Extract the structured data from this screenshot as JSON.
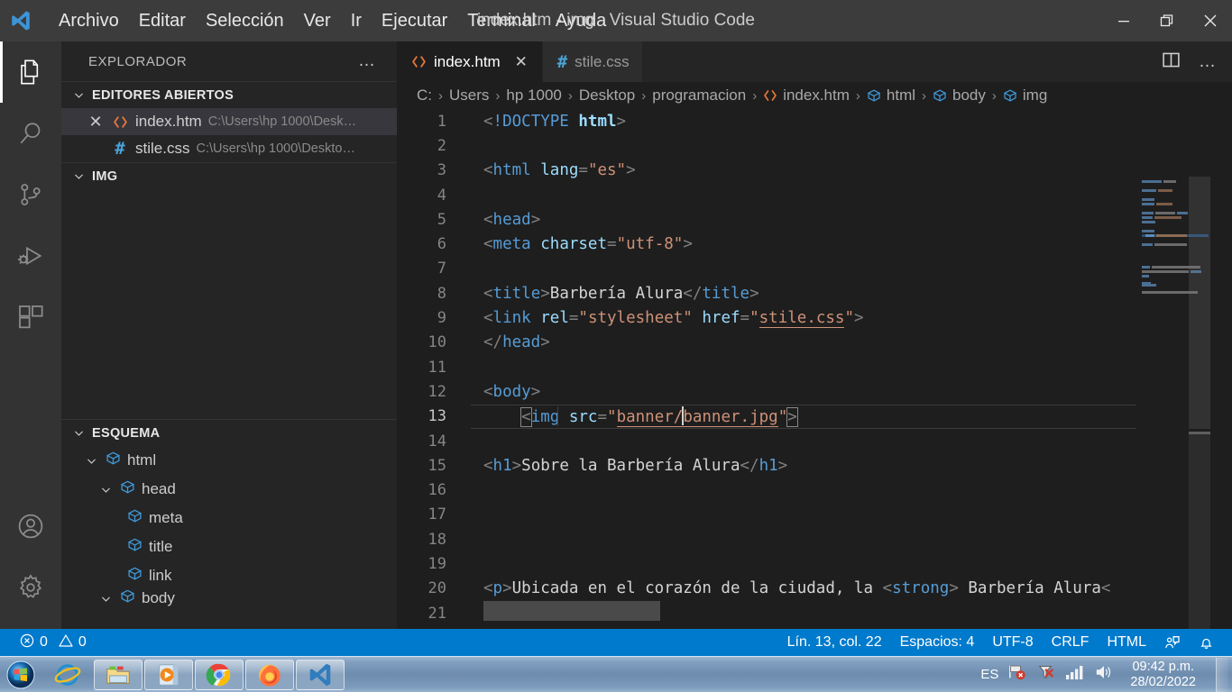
{
  "window": {
    "title": "index.htm - img - Visual Studio Code",
    "minimize": "minimize-icon",
    "restore": "restore-icon",
    "close": "close-icon"
  },
  "menubar": {
    "items": [
      {
        "label": "Archivo"
      },
      {
        "label": "Editar"
      },
      {
        "label": "Selección"
      },
      {
        "label": "Ver"
      },
      {
        "label": "Ir"
      },
      {
        "label": "Ejecutar"
      },
      {
        "label": "Terminal"
      },
      {
        "label": "Ayuda"
      }
    ]
  },
  "activitybar": {
    "items": [
      {
        "name": "explorer-icon",
        "active": true
      },
      {
        "name": "search-icon",
        "active": false
      },
      {
        "name": "source-control-icon",
        "active": false
      },
      {
        "name": "run-and-debug-icon",
        "active": false
      },
      {
        "name": "extensions-icon",
        "active": false
      }
    ],
    "bottom": [
      {
        "name": "accounts-icon"
      },
      {
        "name": "manage-settings-icon"
      }
    ]
  },
  "sidebar": {
    "title": "EXPLORADOR",
    "more_actions": "…",
    "open_editors": {
      "label": "EDITORES ABIERTOS",
      "expanded": true,
      "items": [
        {
          "name": "index.htm",
          "path": "C:\\Users\\hp 1000\\Desk…",
          "icon": "html-file-icon",
          "selected": true,
          "close": "✕"
        },
        {
          "name": "stile.css",
          "path": "C:\\Users\\hp 1000\\Deskto…",
          "icon": "css-file-icon",
          "selected": false,
          "close": ""
        }
      ]
    },
    "folder": {
      "label": "IMG",
      "expanded": true
    },
    "outline": {
      "label": "ESQUEMA",
      "expanded": true,
      "items": [
        {
          "label": "html",
          "depth": 1,
          "chevron": "⌄",
          "icon": "symbol-field-icon"
        },
        {
          "label": "head",
          "depth": 2,
          "chevron": "⌄",
          "icon": "symbol-field-icon"
        },
        {
          "label": "meta",
          "depth": 3,
          "chevron": "",
          "icon": "symbol-field-icon"
        },
        {
          "label": "title",
          "depth": 3,
          "chevron": "",
          "icon": "symbol-field-icon"
        },
        {
          "label": "link",
          "depth": 3,
          "chevron": "",
          "icon": "symbol-field-icon"
        },
        {
          "label": "body",
          "depth": 2,
          "chevron": "⌄",
          "icon": "symbol-field-icon"
        }
      ]
    }
  },
  "editor": {
    "tabs": [
      {
        "label": "index.htm",
        "icon": "html-file-icon",
        "active": true,
        "close": "✕"
      },
      {
        "label": "stile.css",
        "icon": "css-file-icon",
        "active": false,
        "close": ""
      }
    ],
    "tab_actions": [
      {
        "name": "split-editor-icon"
      },
      {
        "name": "more-actions-icon",
        "label": "…"
      }
    ],
    "breadcrumb": [
      {
        "label": "C:",
        "icon": ""
      },
      {
        "label": "Users",
        "icon": ""
      },
      {
        "label": "hp 1000",
        "icon": ""
      },
      {
        "label": "Desktop",
        "icon": ""
      },
      {
        "label": "programacion",
        "icon": ""
      },
      {
        "label": "index.htm",
        "icon": "html-file-icon"
      },
      {
        "label": "html",
        "icon": "symbol-field-icon"
      },
      {
        "label": "body",
        "icon": "symbol-field-icon"
      },
      {
        "label": "img",
        "icon": "symbol-field-icon"
      }
    ],
    "breadcrumb_separator": "›",
    "lines": [
      {
        "n": "1",
        "tokens": [
          {
            "t": "<!DOCTYPE html>",
            "c": "doctype"
          }
        ]
      },
      {
        "n": "2",
        "tokens": []
      },
      {
        "n": "3",
        "tokens": [
          {
            "t": "<html lang=\"es\">",
            "c": "tag"
          }
        ]
      },
      {
        "n": "4",
        "tokens": []
      },
      {
        "n": "5",
        "tokens": [
          {
            "t": "<head>",
            "c": "tag"
          }
        ]
      },
      {
        "n": "6",
        "tokens": [
          {
            "t": "<meta charset=\"utf-8\">",
            "c": "tag"
          }
        ]
      },
      {
        "n": "7",
        "tokens": []
      },
      {
        "n": "8",
        "tokens": [
          {
            "t": "<title>Barbería Alura</title>",
            "c": "tag"
          }
        ]
      },
      {
        "n": "9",
        "tokens": [
          {
            "t": "<link rel=\"stylesheet\" href=\"stile.css\">",
            "c": "tag"
          }
        ]
      },
      {
        "n": "10",
        "tokens": [
          {
            "t": "</head>",
            "c": "tag"
          }
        ]
      },
      {
        "n": "11",
        "tokens": []
      },
      {
        "n": "12",
        "tokens": [
          {
            "t": "<body>",
            "c": "tag"
          }
        ]
      },
      {
        "n": "13",
        "tokens": [
          {
            "t": "    <img src=\"banner/banner.jpg\">",
            "c": "tag"
          }
        ],
        "active": true
      },
      {
        "n": "14",
        "tokens": []
      },
      {
        "n": "15",
        "tokens": [
          {
            "t": "<h1>Sobre la Barbería Alura</h1>",
            "c": "tag"
          }
        ]
      },
      {
        "n": "16",
        "tokens": []
      },
      {
        "n": "17",
        "tokens": []
      },
      {
        "n": "18",
        "tokens": []
      },
      {
        "n": "19",
        "tokens": []
      },
      {
        "n": "20",
        "tokens": [
          {
            "t": "<p>Ubicada en el corazón de la ciudad, la <strong> Barbería Alura<",
            "c": "tag"
          }
        ]
      },
      {
        "n": "21",
        "tokens": []
      }
    ]
  },
  "statusbar": {
    "errors": "0",
    "warnings": "0",
    "cursor_position": "Lín. 13, col. 22",
    "indentation": "Espacios: 4",
    "encoding": "UTF-8",
    "eol": "CRLF",
    "language": "HTML",
    "feedback_icon": "feedback-icon",
    "bell_icon": "notifications-bell-icon",
    "accent": "#007acc"
  },
  "taskbar": {
    "start": "windows-start-orb",
    "apps": [
      {
        "name": "internet-explorer-icon",
        "running": false
      },
      {
        "name": "file-explorer-icon",
        "running": true
      },
      {
        "name": "windows-media-player-icon",
        "running": true
      },
      {
        "name": "google-chrome-icon",
        "running": true
      },
      {
        "name": "mozilla-firefox-icon",
        "running": true
      },
      {
        "name": "visual-studio-code-icon",
        "running": true
      }
    ],
    "tray": {
      "language": "ES",
      "icons": [
        "network-error-icon",
        "action-center-error-icon",
        "signal-bars-icon",
        "volume-icon"
      ],
      "time": "09:42 p.m.",
      "date": "28/02/2022"
    }
  }
}
